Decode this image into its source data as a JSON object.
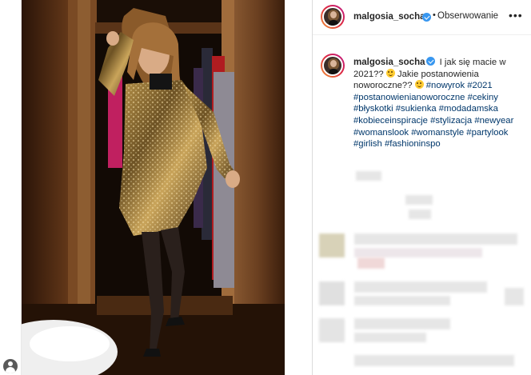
{
  "post": {
    "username": "malgosia_socha",
    "header_dot": "•",
    "follow_label": "Obserwowanie",
    "more_label": "•••",
    "caption_text_1": "I jak się macie w 2021?? ",
    "caption_text_2": " Jakie postanowienia noworoczne?? ",
    "caption_emoji_1": "grinning-face-emoji",
    "caption_emoji_2": "thinking-face-emoji",
    "hashtags": {
      "h1": "#nowyrok",
      "h2": "#2021",
      "h3": "#postanowienianoworoczne",
      "h4": "#cekiny",
      "h5": "#błyskotki",
      "h6": "#sukienka",
      "h7": "#modadamska",
      "h8": "#kobieceinspiracje",
      "h9": "#stylizacja",
      "h10": "#newyear",
      "h11": "#womanslook",
      "h12": "#womanstyle",
      "h13": "#partylook",
      "h14": "#girlish",
      "h15": "#fashioninspo"
    }
  },
  "icons": {
    "verified": "verified-badge-icon",
    "more": "more-options-icon",
    "user": "user-avatar-icon"
  },
  "colors": {
    "hashtag": "#00376b",
    "verified": "#3897f0",
    "story_ring_start": "#f09433",
    "story_ring_end": "#bc1888"
  }
}
